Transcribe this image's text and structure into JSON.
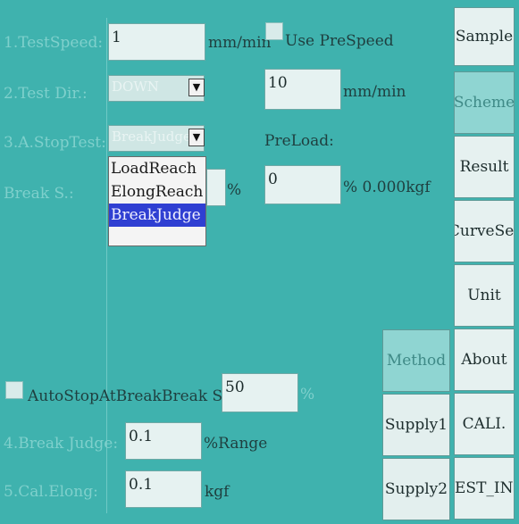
{
  "form": {
    "test_speed": {
      "label": "1.TestSpeed:",
      "value": "1",
      "unit": "mm/min"
    },
    "use_prespeed": {
      "label": "Use PreSpeed",
      "value": "10",
      "unit": "mm/min"
    },
    "test_dir": {
      "label": "2.Test Dir.:",
      "value": "DOWN"
    },
    "stop_test": {
      "label": "3.A.StopTest:",
      "value": "BreakJudge"
    },
    "preload": {
      "label": "PreLoad:",
      "value": "0",
      "unit": "% 0.000kgf"
    },
    "break_s": {
      "label": "Break S.:",
      "unit": "%"
    },
    "dropdown_options": [
      "LoadReach",
      "ElongReach",
      "BreakJudge"
    ],
    "auto_stop": {
      "label": "AutoStopAtBreak",
      "break_label": "Break S.",
      "value": "50",
      "unit": "%"
    },
    "break_judge": {
      "label": "4.Break Judge:",
      "value": "0.1",
      "unit": "%Range"
    },
    "cal_elong": {
      "label": "5.Cal.Elong:",
      "value": "0.1",
      "unit": "kgf"
    }
  },
  "side_menu": [
    "Sample",
    "Scheme",
    "Result",
    "CurveSet",
    "Unit",
    "About",
    "CALI.",
    "TEST_INF"
  ],
  "bottom_menu": [
    "Method",
    "Supply1",
    "Supply2"
  ],
  "icons": {
    "dropdown_arrow": "▼"
  },
  "colors": {
    "background": "#3fb2ae",
    "selection": "#2f3fd2"
  }
}
